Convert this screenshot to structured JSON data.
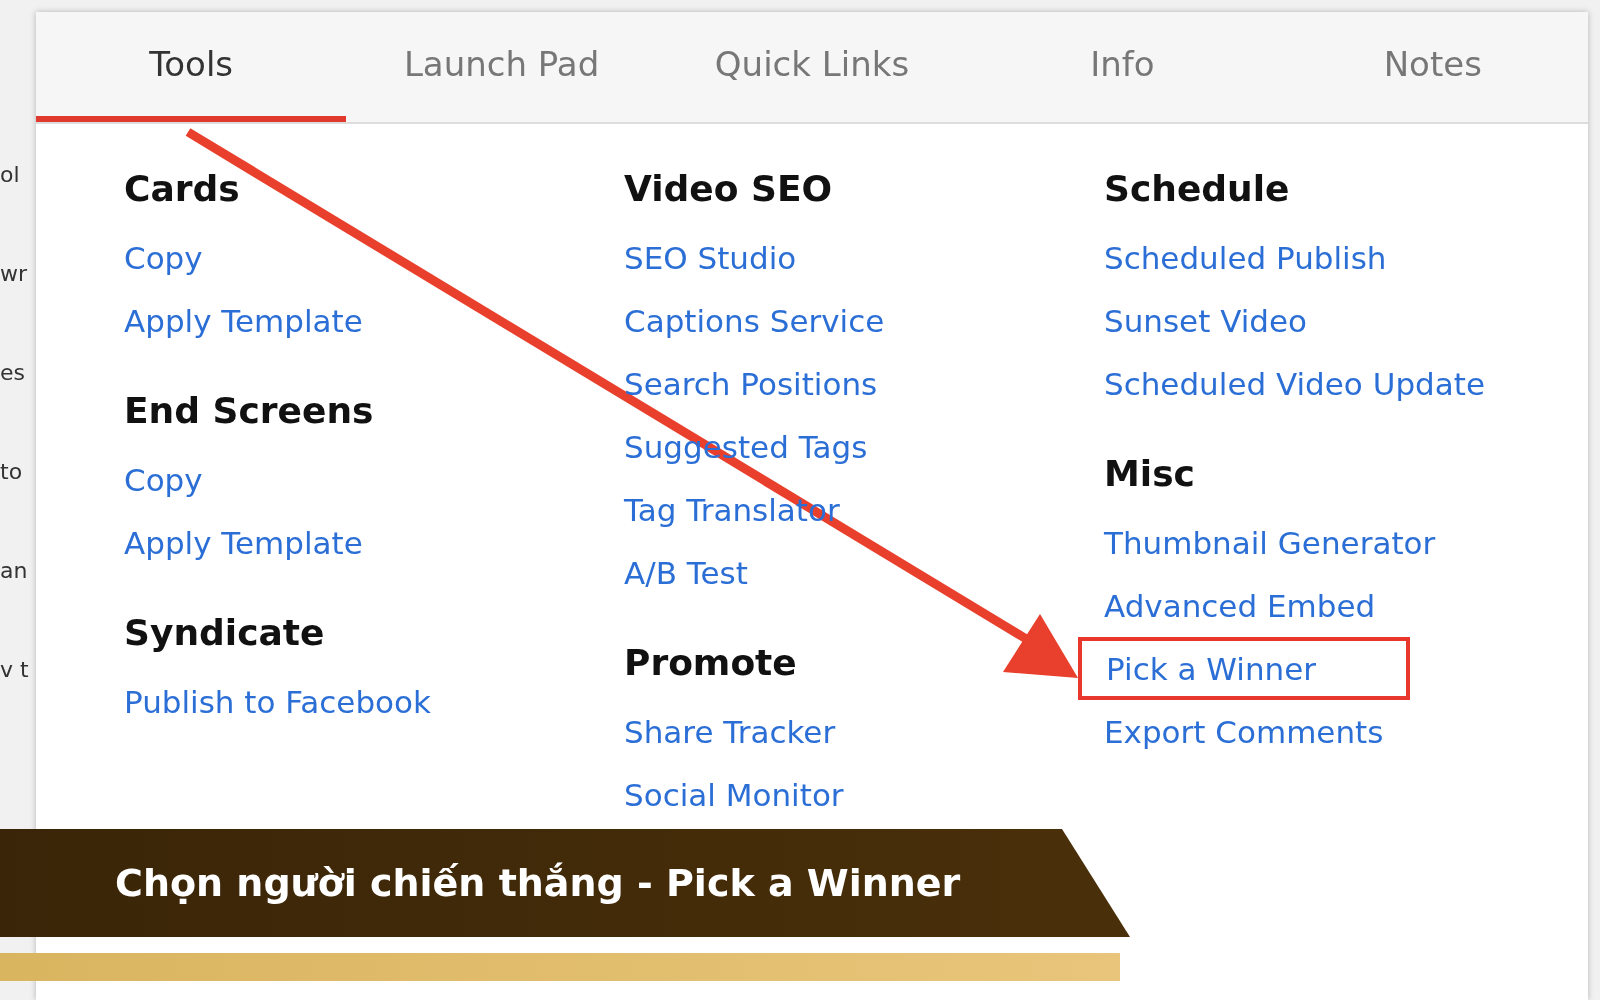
{
  "background_fragments": [
    "ol",
    "wr",
    "es",
    "to",
    "an",
    "v t"
  ],
  "tabs": [
    {
      "label": "Tools",
      "selected": true
    },
    {
      "label": "Launch Pad",
      "selected": false
    },
    {
      "label": "Quick Links",
      "selected": false
    },
    {
      "label": "Info",
      "selected": false
    },
    {
      "label": "Notes",
      "selected": false
    }
  ],
  "columns": [
    {
      "sections": [
        {
          "heading": "Cards",
          "links": [
            {
              "label": "Copy",
              "highlighted": false
            },
            {
              "label": "Apply Template",
              "highlighted": false
            }
          ]
        },
        {
          "heading": "End Screens",
          "links": [
            {
              "label": "Copy",
              "highlighted": false
            },
            {
              "label": "Apply Template",
              "highlighted": false
            }
          ]
        },
        {
          "heading": "Syndicate",
          "links": [
            {
              "label": "Publish to Facebook",
              "highlighted": false
            }
          ]
        }
      ]
    },
    {
      "sections": [
        {
          "heading": "Video SEO",
          "links": [
            {
              "label": "SEO Studio",
              "highlighted": false
            },
            {
              "label": "Captions Service",
              "highlighted": false
            },
            {
              "label": "Search Positions",
              "highlighted": false
            },
            {
              "label": "Suggested Tags",
              "highlighted": false
            },
            {
              "label": "Tag Translator",
              "highlighted": false
            },
            {
              "label": "A/B Test",
              "highlighted": false
            }
          ]
        },
        {
          "heading": "Promote",
          "links": [
            {
              "label": "Share Tracker",
              "highlighted": false
            },
            {
              "label": "Social Monitor",
              "highlighted": false
            }
          ]
        }
      ]
    },
    {
      "sections": [
        {
          "heading": "Schedule",
          "links": [
            {
              "label": "Scheduled Publish",
              "highlighted": false
            },
            {
              "label": "Sunset Video",
              "highlighted": false
            },
            {
              "label": "Scheduled Video Update",
              "highlighted": false
            }
          ]
        },
        {
          "heading": "Misc",
          "links": [
            {
              "label": "Thumbnail Generator",
              "highlighted": false
            },
            {
              "label": "Advanced Embed",
              "highlighted": false
            },
            {
              "label": "Pick a Winner",
              "highlighted": true
            },
            {
              "label": "Export Comments",
              "highlighted": false
            }
          ]
        }
      ]
    }
  ],
  "caption": "Chọn người chiến thắng - Pick a Winner"
}
